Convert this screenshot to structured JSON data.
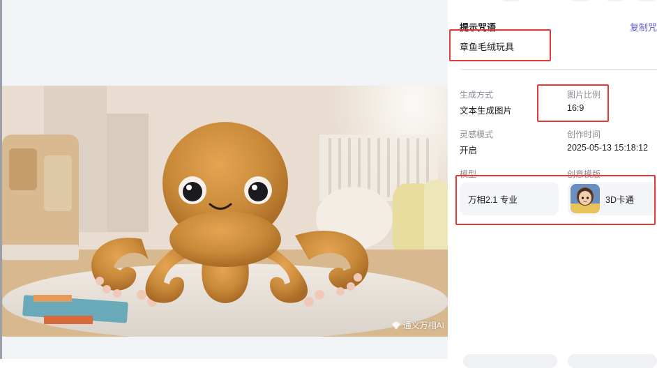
{
  "image": {
    "watermark": "通义万相AI"
  },
  "panel": {
    "prompt_title": "提示咒语",
    "copy_label": "复制咒",
    "prompt_text": "章鱼毛绒玩具",
    "fields": {
      "gen_method_label": "生成方式",
      "gen_method_value": "文本生成图片",
      "ratio_label": "图片比例",
      "ratio_value": "16:9",
      "inspiration_label": "灵感模式",
      "inspiration_value": "开启",
      "created_label": "创作时间",
      "created_value": "2025-05-13 15:18:12",
      "model_label": "模型",
      "template_label": "创意模版"
    },
    "model_card": "万相2.1 专业",
    "template_card": "3D卡通"
  },
  "colors": {
    "accent_link": "#5b5bd6",
    "highlight_box": "#e53935"
  }
}
